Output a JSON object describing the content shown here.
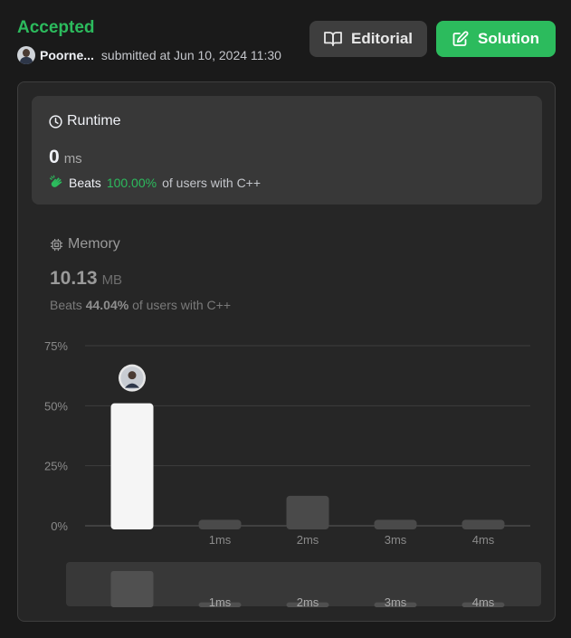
{
  "header": {
    "status": "Accepted",
    "username": "Poorne...",
    "submitted_text": "submitted at Jun 10, 2024 11:30",
    "editorial_label": "Editorial",
    "solution_label": "Solution"
  },
  "runtime": {
    "title": "Runtime",
    "value": "0",
    "unit": "ms",
    "beats_label": "Beats",
    "beats_pct": "100.00%",
    "beats_suffix": "of users with C++"
  },
  "memory": {
    "title": "Memory",
    "value": "10.13",
    "unit": "MB",
    "beats_label": "Beats",
    "beats_pct": "44.04%",
    "beats_suffix": "of users with C++"
  },
  "colors": {
    "accent": "#2cbb5d",
    "bar_highlight": "#f5f5f5",
    "bar_default": "#4a4a4a",
    "panel": "#262626"
  },
  "chart_data": {
    "type": "bar",
    "categories": [
      "",
      "1ms",
      "2ms",
      "3ms",
      "4ms"
    ],
    "values": [
      51,
      2.5,
      12.5,
      2.5,
      2.5
    ],
    "highlight_index": 0,
    "ylim": [
      0,
      75
    ],
    "yticks": [
      "0%",
      "25%",
      "50%",
      "75%"
    ],
    "ytick_values": [
      0,
      25,
      50,
      75
    ],
    "overview_values": [
      30,
      4,
      4,
      4,
      4
    ],
    "overview_labels": [
      "",
      "1ms",
      "2ms",
      "3ms",
      "4ms"
    ]
  }
}
